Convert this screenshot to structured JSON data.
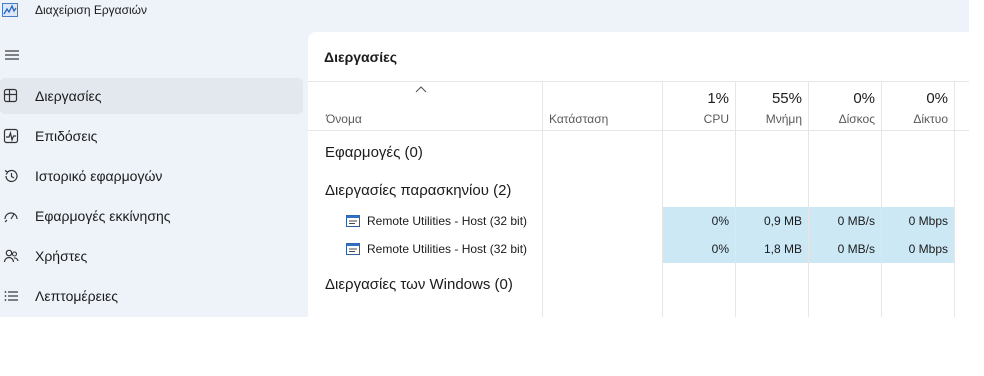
{
  "app": {
    "title": "Διαχείριση Εργασιών"
  },
  "sidebar": {
    "items": [
      {
        "label": "Διεργασίες",
        "icon": "processes-icon",
        "active": true
      },
      {
        "label": "Επιδόσεις",
        "icon": "performance-icon"
      },
      {
        "label": "Ιστορικό εφαρμογών",
        "icon": "history-icon"
      },
      {
        "label": "Εφαρμογές εκκίνησης",
        "icon": "startup-icon"
      },
      {
        "label": "Χρήστες",
        "icon": "users-icon"
      },
      {
        "label": "Λεπτομέρειες",
        "icon": "details-icon"
      }
    ]
  },
  "main": {
    "title": "Διεργασίες",
    "columns": {
      "name": "Όνομα",
      "status": "Κατάσταση",
      "cpu": {
        "pct": "1%",
        "label": "CPU"
      },
      "memory": {
        "pct": "55%",
        "label": "Μνήμη"
      },
      "disk": {
        "pct": "0%",
        "label": "Δίσκος"
      },
      "network": {
        "pct": "0%",
        "label": "Δίκτυο"
      }
    },
    "groups": {
      "apps": "Εφαρμογές (0)",
      "background": "Διεργασίες παρασκηνίου (2)",
      "windows": "Διεργασίες των Windows (0)"
    },
    "rows": [
      {
        "name": "Remote Utilities - Host (32 bit)",
        "cpu": "0%",
        "memory": "0,9 MB",
        "disk": "0 MB/s",
        "network": "0 Mbps"
      },
      {
        "name": "Remote Utilities - Host (32 bit)",
        "cpu": "0%",
        "memory": "1,8 MB",
        "disk": "0 MB/s",
        "network": "0 Mbps"
      }
    ]
  },
  "colors": {
    "sidebar_bg": "#eef3fa",
    "active_item": "#e3e8ef",
    "highlight_cell": "#cce8f5"
  }
}
